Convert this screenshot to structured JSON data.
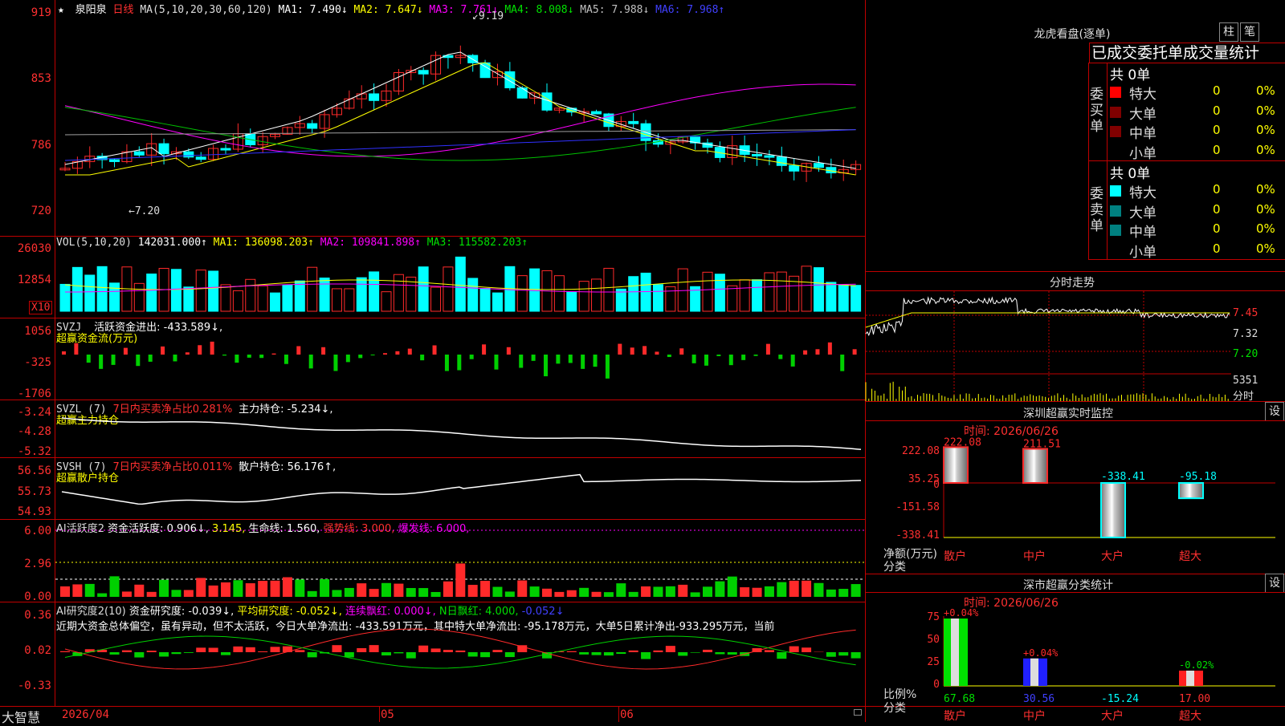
{
  "colors": {
    "up": "#ff2a2a",
    "down": "#00ffff",
    "grid": "#c00000",
    "ma1": "#ffffff",
    "ma2": "#ffff00",
    "ma3": "#ff00ff",
    "ma4": "#00c000",
    "ma5": "#a0a0a0",
    "ma6": "#3030ff"
  },
  "header": {
    "star": "★",
    "name": "泉阳泉",
    "period": "日线",
    "ma_label": "MA(5,10,20,30,60,120)",
    "ma1": "MA1: 7.490↓",
    "ma2": "MA2: 7.647↓",
    "ma3": "MA3: 7.761↓",
    "ma4": "MA4: 8.008↓",
    "ma5": "MA5: 7.988↓",
    "ma6": "MA6: 7.968↑"
  },
  "price_axis": [
    "919",
    "853",
    "786",
    "720"
  ],
  "price_high_label": "9.19",
  "price_low_label": "7.20",
  "vol": {
    "label": "VOL(5,10,20)",
    "val": "142031.000↑",
    "ma1": "MA1: 136098.203↑",
    "ma2": "MA2: 109841.898↑",
    "ma3": "MA3: 115582.203↑",
    "axis": [
      "26030",
      "12854"
    ],
    "unit": "X10"
  },
  "svzj": {
    "label": "SVZJ",
    "text": "活跃资金进出: -433.589↓,",
    "sub": "超赢资金流(万元)",
    "axis": [
      "1056",
      "-325",
      "-1706"
    ]
  },
  "svzl": {
    "label": "SVZL (7)",
    "red": "7日内买卖净占比0.281%",
    "text": "主力持仓: -5.234↓,",
    "sub": "超赢主力持仓",
    "axis": [
      "-3.24",
      "-4.28",
      "-5.32"
    ]
  },
  "svsh": {
    "label": "SVSH (7)",
    "red": "7日内买卖净占比0.011%",
    "text": "散户持仓: 56.176↑,",
    "sub": "超赢散户持仓",
    "axis": [
      "56.56",
      "55.73",
      "54.93"
    ]
  },
  "ai2": {
    "label": "AI活跃度2",
    "t1": "资金活跃度: 0.906↓,",
    "t2": "3.145,",
    "t3": "生命线: 1.560,",
    "t4": "强势线: 3.000,",
    "t5": "爆发线: 6.000,",
    "axis": [
      "6.00",
      "2.96",
      "0.00"
    ]
  },
  "ai3": {
    "label": "AI研究度2(10)",
    "t1": "资金研究度: -0.039↓,",
    "t2": "平均研究度: -0.052↓,",
    "t3": "连续飘红: 0.000↓,",
    "t4": "N日飘红: 4.000,",
    "t5": "-0.052↓",
    "desc": "近期大资金总体偏空，虽有异动，但不太活跃，今日大单净流出: -433.591万元，其中特大单净流出: -95.178万元，大单5日累计净出-933.295万元，当前",
    "axis": [
      "0.36",
      "0.02",
      "-0.33"
    ]
  },
  "xaxis": {
    "brand": "大智慧",
    "d1": "2026/04",
    "d2": "05",
    "d3": "06"
  },
  "lhb": {
    "title": "龙虎看盘(逐单)",
    "btn1": "柱",
    "btn2": "笔",
    "head": "已成交委托单成交量统计",
    "buy_label": "委买单",
    "sell_label": "委卖单",
    "buy_total": "共 0单",
    "sell_total": "共 0单",
    "rows": [
      {
        "name": "特大",
        "qty": "0",
        "pct": "0%"
      },
      {
        "name": "大单",
        "qty": "0",
        "pct": "0%"
      },
      {
        "name": "中单",
        "qty": "0",
        "pct": "0%"
      },
      {
        "name": "小单",
        "qty": "0",
        "pct": "0%"
      }
    ]
  },
  "intraday": {
    "title": "分时走势",
    "axis": [
      "7.45",
      "7.32",
      "7.20"
    ],
    "vol": "5351",
    "vol_label": "分时"
  },
  "monitor": {
    "title": "深圳超赢实时监控",
    "btn": "设",
    "time": "时间: 2026/06/26",
    "axis": [
      "222.08",
      "35.25",
      "0",
      "-151.58",
      "-338.41"
    ],
    "ylabel": "净额(万元)",
    "xlabel": "分类",
    "bars": [
      {
        "cat": "散户",
        "value": 222.08,
        "label": "222.08"
      },
      {
        "cat": "中户",
        "value": 211.51,
        "label": "211.51"
      },
      {
        "cat": "大户",
        "value": -338.41,
        "label": "-338.41"
      },
      {
        "cat": "超大",
        "value": -95.18,
        "label": "-95.18"
      }
    ]
  },
  "classify": {
    "title": "深市超赢分类统计",
    "btn": "设",
    "time": "时间: 2026/06/26",
    "axis": [
      "75",
      "50",
      "25",
      "0"
    ],
    "ylabel": "比例%",
    "xlabel": "分类",
    "bars": [
      {
        "cat": "散户",
        "pct": 75,
        "top": "+0.04%",
        "bottom": "67.68"
      },
      {
        "cat": "中户",
        "pct": 30.56,
        "top": "+0.04%",
        "bottom": "30.56"
      },
      {
        "cat": "大户",
        "pct": 0,
        "top": "",
        "bottom": "-15.24"
      },
      {
        "cat": "超大",
        "pct": 17,
        "top": "-0.02%",
        "bottom": "17.00"
      }
    ]
  }
}
